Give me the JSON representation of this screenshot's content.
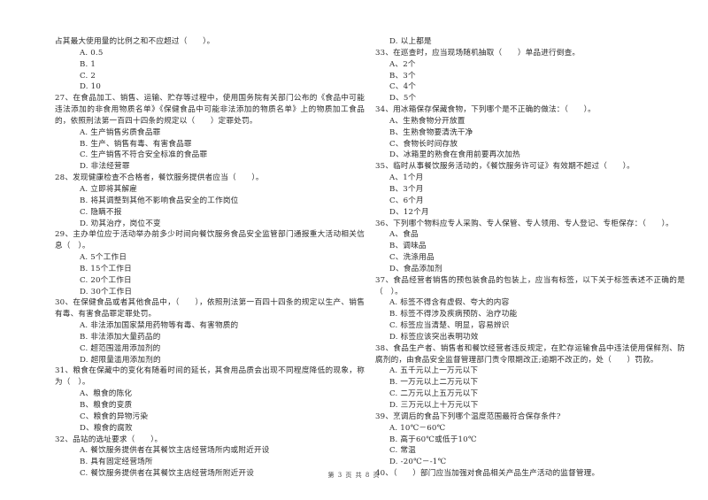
{
  "left_column": [
    {
      "type": "cont",
      "text": "占其最大使用量的比例之和不应超过（　　）。"
    },
    {
      "type": "opt",
      "text": "A. 0.5"
    },
    {
      "type": "opt",
      "text": "B. 1"
    },
    {
      "type": "opt",
      "text": "C. 2"
    },
    {
      "type": "opt",
      "text": "D. 10"
    },
    {
      "type": "q",
      "text": "27、在食品加工、销售、运输、贮存等过程中，使用国务院有关部门公布的《食品中可能违法添加的非食用物质名单》《保健食品中可能非法添加的物质名单》上的物质加工食品的，依照刑法第一百四十四条的规定以（　　）定罪处罚。"
    },
    {
      "type": "opt",
      "text": "A. 生产销售劣质食品罪"
    },
    {
      "type": "opt",
      "text": "B. 生产、销售有毒、有害食品罪"
    },
    {
      "type": "opt",
      "text": "C. 生产销售不符合安全标准的食品罪"
    },
    {
      "type": "opt",
      "text": "D. 非法经营罪"
    },
    {
      "type": "q",
      "text": "28、发现健康检查不合格者，餐饮服务提供者应当（　　）。"
    },
    {
      "type": "opt",
      "text": "A. 立即将其解雇"
    },
    {
      "type": "opt",
      "text": "B. 将其调整到其他不影响食品安全的工作岗位"
    },
    {
      "type": "opt",
      "text": "C. 隐瞒不报"
    },
    {
      "type": "opt",
      "text": "D. 劝其治疗，岗位不变"
    },
    {
      "type": "q",
      "text": "29、主办单位应于活动举办前多少时间向餐饮服务食品安全监管部门通报重大活动相关信息（　）。"
    },
    {
      "type": "opt",
      "text": "A. 5个工作日"
    },
    {
      "type": "opt",
      "text": "B. 15个工作日"
    },
    {
      "type": "opt",
      "text": "C. 20个工作日"
    },
    {
      "type": "opt",
      "text": "D. 30个工作日"
    },
    {
      "type": "q",
      "text": "30、在保健食品或者其他食品中，（　　），依照刑法第一百四十四条的规定以生产、销售有毒、有害食品罪定罪处罚。"
    },
    {
      "type": "opt",
      "text": "A. 非法添加国家禁用药物等有毒、有害物质的"
    },
    {
      "type": "opt",
      "text": "B. 非法添加大量药品的"
    },
    {
      "type": "opt",
      "text": "C. 超范围滥用添加剂的"
    },
    {
      "type": "opt",
      "text": "D. 超限量滥用添加剂的"
    },
    {
      "type": "q",
      "text": "31、粮食在保藏中的变化有随着时间的延长，其食用品质会出现不同程度降低的现象，称为（　）。"
    },
    {
      "type": "opt",
      "text": "A、粮食的陈化"
    },
    {
      "type": "opt",
      "text": "B、粮食的变质"
    },
    {
      "type": "opt",
      "text": "C、粮食的异物污染"
    },
    {
      "type": "opt",
      "text": "D、粮食的腐败"
    },
    {
      "type": "q",
      "text": "32、品站的选址要求（　　）。"
    },
    {
      "type": "opt",
      "text": "A. 餐饮服务提供者在其餐饮主店经营场所内或附近开设"
    },
    {
      "type": "opt",
      "text": "B. 具有固定经营场所"
    },
    {
      "type": "opt",
      "text": "C. 餐饮服务提供者在其餐饮主店经营场所附近开设"
    }
  ],
  "right_column": [
    {
      "type": "opt",
      "text": "D. 以上都是"
    },
    {
      "type": "q",
      "text": "33、在巡查时，应当现场随机抽取（　　）单品进行倒查。"
    },
    {
      "type": "opt",
      "text": "A、2个"
    },
    {
      "type": "opt",
      "text": "B、3个"
    },
    {
      "type": "opt",
      "text": "C、4个"
    },
    {
      "type": "opt",
      "text": "D、5个"
    },
    {
      "type": "q",
      "text": "34、用冰箱保存保藏食物，下列哪个是不正确的做法：（　　）。"
    },
    {
      "type": "opt",
      "text": "A、生熟食物分开放置"
    },
    {
      "type": "opt",
      "text": "B、生熟食物要清洗干净"
    },
    {
      "type": "opt",
      "text": "C、食物长时间存放"
    },
    {
      "type": "opt",
      "text": "D、冰箱里的熟食在食用前要再次加热"
    },
    {
      "type": "q",
      "text": "35、临时从事餐饮服务活动的，《餐饮服务许可证》有效期不超过（　　）。"
    },
    {
      "type": "opt",
      "text": "A、1个月"
    },
    {
      "type": "opt",
      "text": "B、3个月"
    },
    {
      "type": "opt",
      "text": "C、6个月"
    },
    {
      "type": "opt",
      "text": "D、12个月"
    },
    {
      "type": "q",
      "text": "36、下列哪个物料应专人采购、专人保管、专人领用、专人登记、专柜保存：（　　）。"
    },
    {
      "type": "opt",
      "text": "A、食品"
    },
    {
      "type": "opt",
      "text": "B、调味品"
    },
    {
      "type": "opt",
      "text": "C、洗涤用品"
    },
    {
      "type": "opt",
      "text": "D、食品添加剂"
    },
    {
      "type": "q",
      "text": "37、食品经营者销售的预包装食品的包装上，应当有标签，以下关于标签表述不正确的是（　）。"
    },
    {
      "type": "opt",
      "text": "A. 标签不得含有虚假、夸大的内容"
    },
    {
      "type": "opt",
      "text": "B. 标签不得涉及疾病预防、治疗功能"
    },
    {
      "type": "opt",
      "text": "C. 标签应当清楚、明显，容易辨识"
    },
    {
      "type": "opt",
      "text": "D. 标签应该突出表明功效"
    },
    {
      "type": "q",
      "text": "38、食品生产者、销售者和餐饮经营者违反规定，在贮存运输食品中违法使用保鲜剂、防腐剂的，由食品安全监督管理部门责令限期改正;逾期不改正的，处（　　）罚款。"
    },
    {
      "type": "opt",
      "text": "A. 五千元以上一万元以下"
    },
    {
      "type": "opt",
      "text": "B. 一万元以上二万元以下"
    },
    {
      "type": "opt",
      "text": "C. 二万元以上五万元以下"
    },
    {
      "type": "opt",
      "text": "D. 三万元以上十万元以下"
    },
    {
      "type": "q",
      "text": "39、烹调后的食品下列哪个温度范围最符合保存条件?"
    },
    {
      "type": "opt",
      "text": "A. 10℃－60℃"
    },
    {
      "type": "opt",
      "text": "B. 高于60℃或低于10℃"
    },
    {
      "type": "opt",
      "text": "C. 常温"
    },
    {
      "type": "opt",
      "text": "D. -20℃－-1℃"
    },
    {
      "type": "q",
      "text": "40、（　　）部门应当加强对食品相关产品生产活动的监督管理。"
    }
  ],
  "footer": {
    "page_label": "第 3 页 共 8 页"
  }
}
